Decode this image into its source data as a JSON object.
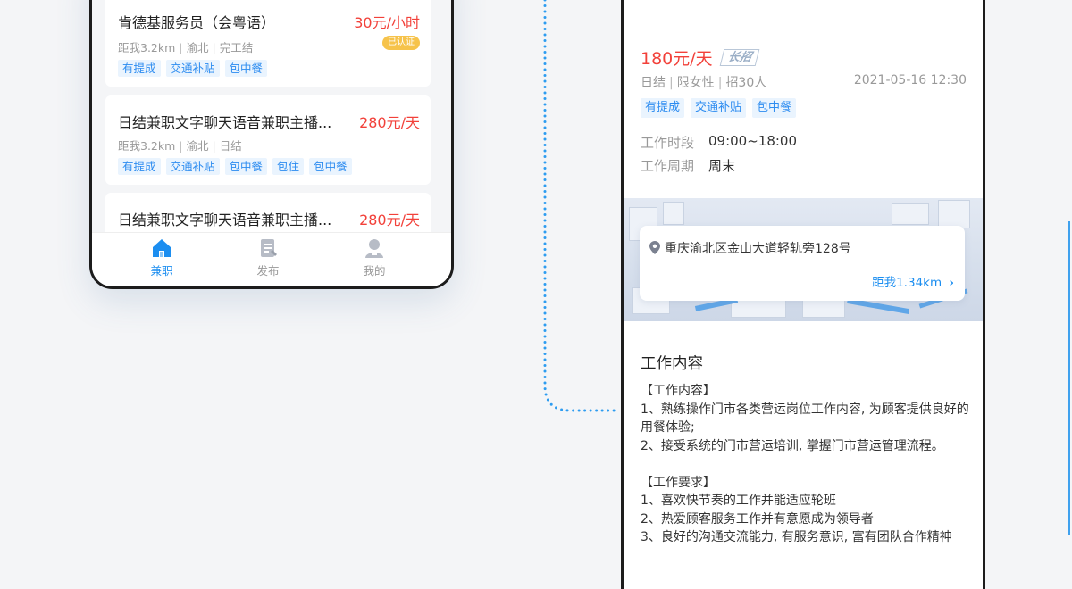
{
  "left_phone": {
    "jobs": [
      {
        "title": "肯德基服务员（会粤语）",
        "price": "30元/小时",
        "meta": [
          "距我3.2km",
          "渝北",
          "完工结"
        ],
        "badge": "已认证",
        "tags": [
          "有提成",
          "交通补贴",
          "包中餐"
        ]
      },
      {
        "title": "日结兼职文字聊天语音兼职主播...",
        "price": "280元/天",
        "meta": [
          "距我3.2km",
          "渝北",
          "日结"
        ],
        "tags": [
          "有提成",
          "交通补贴",
          "包中餐",
          "包住",
          "包中餐"
        ]
      },
      {
        "title": "日结兼职文字聊天语音兼职主播...",
        "price": "280元/天"
      }
    ],
    "tabbar": [
      {
        "label": "兼职",
        "icon": "home-icon",
        "active": true
      },
      {
        "label": "发布",
        "icon": "publish-icon",
        "active": false
      },
      {
        "label": "我的",
        "icon": "profile-icon",
        "active": false
      }
    ]
  },
  "right_phone": {
    "salary": "180元/天",
    "badge": "长招",
    "meta": [
      "日结",
      "限女性",
      "招30人"
    ],
    "post_time": "2021-05-16 12:30",
    "tags": [
      "有提成",
      "交通补贴",
      "包中餐"
    ],
    "work_hours_label": "工作时段",
    "work_hours": "09:00~18:00",
    "work_period_label": "工作周期",
    "work_period": "周末",
    "address": "重庆渝北区金山大道轻轨旁128号",
    "distance": "距我1.34km",
    "section_title": "工作内容",
    "description": [
      "【工作内容】",
      "1、熟练操作门市各类营运岗位工作内容, 为顾客提供良好的用餐体验;",
      "2、接受系统的门市营运培训, 掌握门市营运管理流程。",
      "",
      "【工作要求】",
      "1、喜欢快节奏的工作并能适应轮班",
      "2、热爱顾客服务工作并有意愿成为领导者",
      "3、良好的沟通交流能力, 有服务意识, 富有团队合作精神"
    ]
  },
  "colors": {
    "price_red": "#f2413a",
    "accent_blue": "#1c8ef0",
    "tag_bg": "#eaf4fe",
    "badge_yellow": "#f6c34b"
  }
}
